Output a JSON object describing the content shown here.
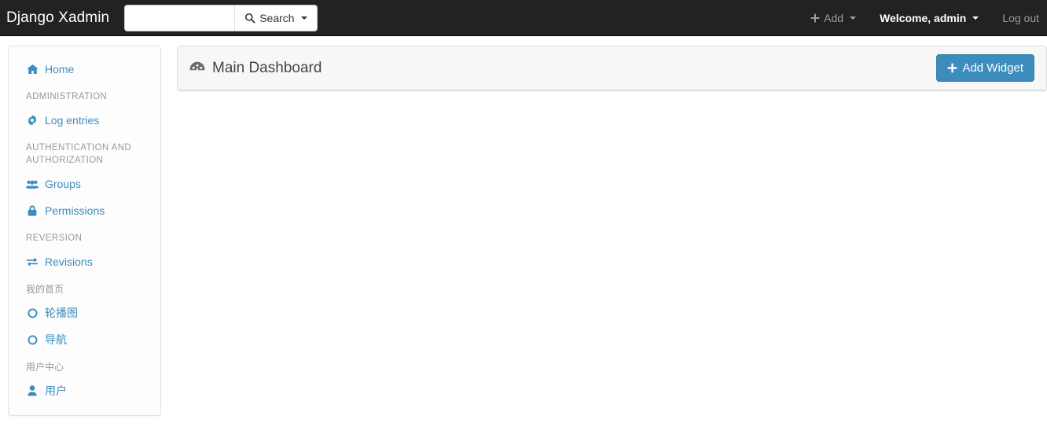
{
  "navbar": {
    "brand": "Django Xadmin",
    "search": {
      "value": "",
      "placeholder": "",
      "button_label": "Search",
      "icon": "search-icon"
    },
    "add_label": "Add",
    "add_icon": "plus-icon",
    "welcome_label": "Welcome, admin",
    "logout_label": "Log out",
    "background_color": "#222222"
  },
  "sidebar": {
    "items": [
      {
        "type": "link",
        "label": "Home",
        "icon": "home-icon"
      },
      {
        "type": "header",
        "label": "ADMINISTRATION"
      },
      {
        "type": "link",
        "label": "Log entries",
        "icon": "gear-icon"
      },
      {
        "type": "header",
        "label": "AUTHENTICATION AND AUTHORIZATION"
      },
      {
        "type": "link",
        "label": "Groups",
        "icon": "users-icon"
      },
      {
        "type": "link",
        "label": "Permissions",
        "icon": "lock-icon"
      },
      {
        "type": "header",
        "label": "REVERSION"
      },
      {
        "type": "link",
        "label": "Revisions",
        "icon": "exchange-icon"
      },
      {
        "type": "header",
        "label": "我的首页"
      },
      {
        "type": "link",
        "label": "轮播图",
        "icon": "circle-o-icon"
      },
      {
        "type": "link",
        "label": "导航",
        "icon": "circle-o-icon"
      },
      {
        "type": "header",
        "label": "用户中心"
      },
      {
        "type": "link",
        "label": "用户",
        "icon": "user-icon"
      }
    ],
    "link_color": "#3b8dbd",
    "header_color": "#999999"
  },
  "dashboard": {
    "title": "Main Dashboard",
    "title_icon": "dashboard-icon",
    "add_widget_label": "Add Widget",
    "add_widget_icon": "plus-icon",
    "add_widget_color": "#3c8dbc"
  }
}
